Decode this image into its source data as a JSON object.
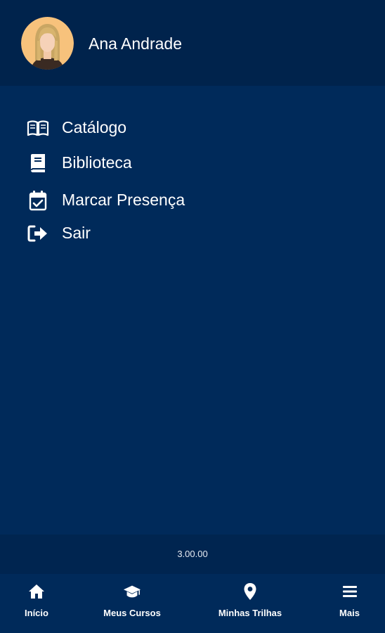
{
  "user": {
    "name": "Ana Andrade"
  },
  "menu": {
    "items": [
      {
        "label": "Catálogo",
        "icon": "book-open-icon"
      },
      {
        "label": "Biblioteca",
        "icon": "book-icon"
      },
      {
        "label": "Marcar Presença",
        "icon": "calendar-check-icon"
      },
      {
        "label": "Sair",
        "icon": "sign-out-icon"
      }
    ]
  },
  "version": "3.00.00",
  "bottom_nav": {
    "items": [
      {
        "label": "Início",
        "icon": "home-icon"
      },
      {
        "label": "Meus Cursos",
        "icon": "graduation-cap-icon"
      },
      {
        "label": "Minhas Trilhas",
        "icon": "map-pin-icon"
      },
      {
        "label": "Mais",
        "icon": "menu-icon"
      }
    ]
  },
  "colors": {
    "background": "#002a5a",
    "header": "#00234c",
    "text": "#ffffff"
  }
}
